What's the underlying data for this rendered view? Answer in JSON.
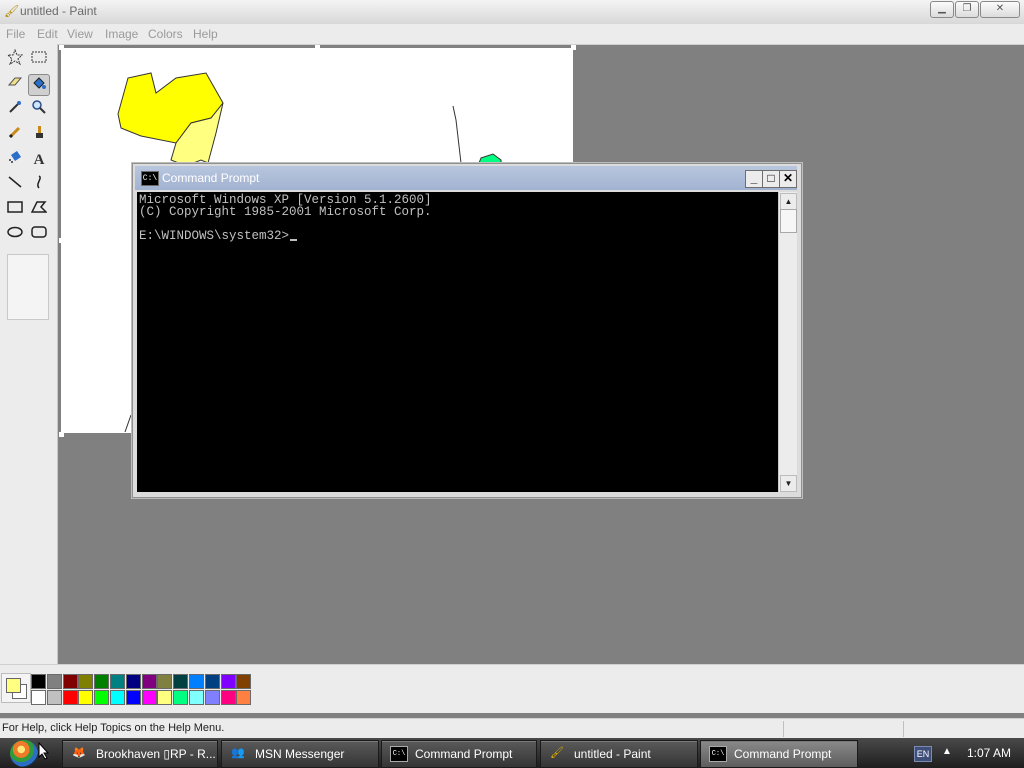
{
  "paint": {
    "title": "untitled - Paint",
    "menu": [
      "File",
      "Edit",
      "View",
      "Image",
      "Colors",
      "Help"
    ],
    "window_controls": [
      "minimize",
      "restore",
      "close"
    ],
    "tools": [
      {
        "name": "free-form-select",
        "icon": "star-select-icon"
      },
      {
        "name": "select",
        "icon": "rect-select-icon"
      },
      {
        "name": "eraser",
        "icon": "eraser-icon"
      },
      {
        "name": "fill-with-color",
        "icon": "fill-bucket-icon",
        "active": true
      },
      {
        "name": "pick-color",
        "icon": "eyedropper-icon"
      },
      {
        "name": "magnifier",
        "icon": "magnifier-icon"
      },
      {
        "name": "pencil",
        "icon": "pencil-icon"
      },
      {
        "name": "brush",
        "icon": "brush-icon"
      },
      {
        "name": "airbrush",
        "icon": "airbrush-icon"
      },
      {
        "name": "text",
        "icon": "text-icon",
        "glyph": "A"
      },
      {
        "name": "line",
        "icon": "line-icon"
      },
      {
        "name": "curve",
        "icon": "curve-icon"
      },
      {
        "name": "rectangle",
        "icon": "rectangle-icon"
      },
      {
        "name": "polygon",
        "icon": "polygon-icon"
      },
      {
        "name": "ellipse",
        "icon": "ellipse-icon"
      },
      {
        "name": "rounded-rectangle",
        "icon": "rounded-rectangle-icon"
      }
    ],
    "foreground_color": "#ffff80",
    "background_color": "#ffffff",
    "palette_row1": [
      "#000000",
      "#808080",
      "#800000",
      "#808000",
      "#008000",
      "#008080",
      "#000080",
      "#800080",
      "#808040",
      "#004040",
      "#0080ff",
      "#004080",
      "#8000ff",
      "#804000"
    ],
    "palette_row2": [
      "#ffffff",
      "#c0c0c0",
      "#ff0000",
      "#ffff00",
      "#00ff00",
      "#00ffff",
      "#0000ff",
      "#ff00ff",
      "#ffff80",
      "#00ff80",
      "#80ffff",
      "#8080ff",
      "#ff0080",
      "#ff8040"
    ],
    "status_text": "For Help, click Help Topics on the Help Menu."
  },
  "cmd": {
    "title": "Command Prompt",
    "lines": [
      "Microsoft Windows XP [Version 5.1.2600]",
      "(C) Copyright 1985-2001 Microsoft Corp.",
      "",
      "E:\\WINDOWS\\system32>"
    ],
    "buttons": {
      "minimize": "_",
      "maximize": "□",
      "close": "✕"
    }
  },
  "taskbar": {
    "buttons": [
      {
        "label": "Brookhaven ▯RP - R...",
        "icon": "browser-icon"
      },
      {
        "label": "MSN Messenger",
        "icon": "msn-icon"
      },
      {
        "label": "Command Prompt",
        "icon": "cmd-icon"
      },
      {
        "label": "untitled - Paint",
        "icon": "paint-icon"
      },
      {
        "label": "Command Prompt",
        "icon": "cmd-icon",
        "active": true
      }
    ],
    "language": "EN",
    "clock": "1:07 AM"
  },
  "colors": {
    "accent_titlebar": "#a2b3d1",
    "workspace": "#808080",
    "drawing_yellow": "#ffff00",
    "drawing_pale_yellow": "#ffff80",
    "drawing_green": "#00ff80"
  }
}
